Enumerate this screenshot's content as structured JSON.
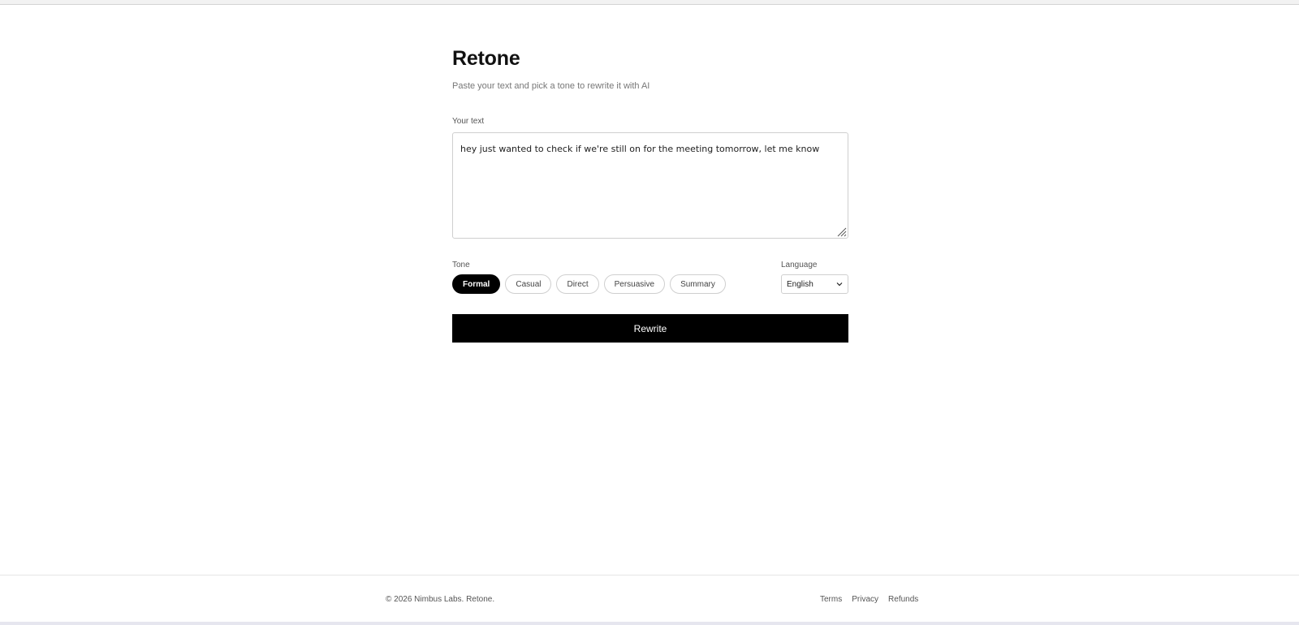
{
  "header": {
    "title": "Retone",
    "subtitle": "Paste your text and pick a tone to rewrite it with AI"
  },
  "input": {
    "label": "Your text",
    "value": "hey just wanted to check if we're still on for the meeting tomorrow, let me know"
  },
  "tone": {
    "label": "Tone",
    "options": [
      "Formal",
      "Casual",
      "Direct",
      "Persuasive",
      "Summary"
    ],
    "selected": "Formal"
  },
  "language": {
    "label": "Language",
    "selected": "English"
  },
  "actions": {
    "rewrite_label": "Rewrite"
  },
  "footer": {
    "copyright": "© 2026 Nimbus Labs. Retone.",
    "links": [
      "Terms",
      "Privacy",
      "Refunds"
    ]
  },
  "colors": {
    "primary": "#000000",
    "background": "#ffffff",
    "muted_text": "#777777",
    "border": "#cfcfcf"
  }
}
